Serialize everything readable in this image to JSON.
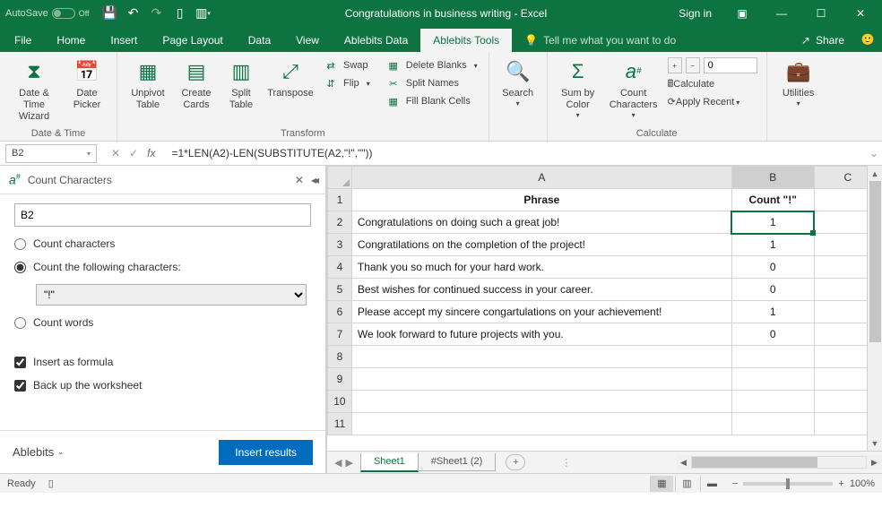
{
  "titlebar": {
    "autosave_label": "AutoSave",
    "autosave_state": "Off",
    "title": "Congratulations in business writing  -  Excel",
    "signin": "Sign in"
  },
  "tabs": {
    "file": "File",
    "home": "Home",
    "insert": "Insert",
    "pagelayout": "Page Layout",
    "data": "Data",
    "view": "View",
    "abdata": "Ablebits Data",
    "abtools": "Ablebits Tools",
    "tellme": "Tell me what you want to do",
    "share": "Share"
  },
  "ribbon": {
    "datetime": {
      "dt_wizard": "Date & Time Wizard",
      "date_picker": "Date Picker",
      "label": "Date & Time"
    },
    "transform": {
      "unpivot": "Unpivot Table",
      "createcards": "Create Cards",
      "splittable": "Split Table",
      "transpose": "Transpose",
      "swap": "Swap",
      "flip": "Flip",
      "label": "Transform"
    },
    "delete": {
      "deleteblanks": "Delete Blanks",
      "splitnames": "Split Names",
      "fillblank": "Fill Blank Cells"
    },
    "search": "Search",
    "calc": {
      "sumby": "Sum by Color",
      "countchars": "Count Characters",
      "calcrow": "Calculate",
      "apply": "Apply Recent",
      "spin_value": "0",
      "label": "Calculate"
    },
    "util": "Utilities"
  },
  "fbar": {
    "name": "B2",
    "formula": "=1*LEN(A2)-LEN(SUBSTITUTE(A2,\"!\",\"\"))"
  },
  "taskpane": {
    "title": "Count Characters",
    "range": "B2",
    "r_countchars": "Count characters",
    "r_countfollowing": "Count the following characters:",
    "charbox": "\"!\"",
    "r_countwords": "Count words",
    "c_insertformula": "Insert as formula",
    "c_backup": "Back up the worksheet",
    "ablebits": "Ablebits",
    "insert_results": "Insert results"
  },
  "chart_data": {
    "type": "table",
    "headers": [
      "Phrase",
      "Count \"!\""
    ],
    "rows": [
      {
        "row": 2,
        "phrase": "Congratulations on doing such a great job!",
        "count": 1
      },
      {
        "row": 3,
        "phrase": "Congratilations on the completion of the project!",
        "count": 1
      },
      {
        "row": 4,
        "phrase": "Thank you so much for your hard work.",
        "count": 0
      },
      {
        "row": 5,
        "phrase": "Best wishes for continued success in your career.",
        "count": 0
      },
      {
        "row": 6,
        "phrase": "Please accept my sincere congartulations on your achievement!",
        "count": 1
      },
      {
        "row": 7,
        "phrase": "We look forward to future projects with you.",
        "count": 0
      }
    ]
  },
  "sheettabs": {
    "active": "Sheet1",
    "inactive": "#Sheet1 (2)"
  },
  "statusbar": {
    "ready": "Ready",
    "zoom": "100%"
  }
}
